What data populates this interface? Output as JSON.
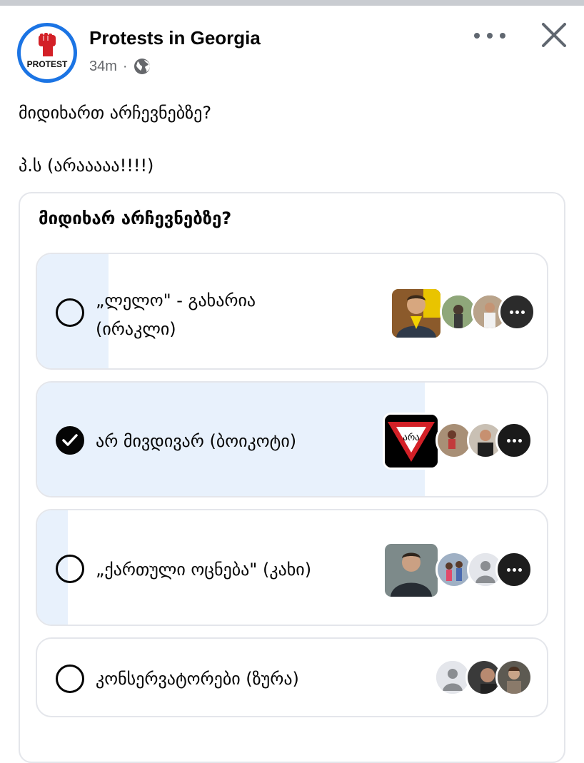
{
  "post": {
    "page_name": "Protests in Georgia",
    "logo_text": "PROTEST",
    "time": "34m",
    "dot": "·",
    "text_line1": "მიდიხართ არჩევნებზე?",
    "text_line2": "პ.ს  (არააააა!!!!)"
  },
  "poll": {
    "question": "მიდიხარ არჩევნებზე?",
    "options": [
      {
        "line1": "„ლელო\" - გახარია",
        "line2": "(ირაკლი)",
        "selected": false,
        "fill_percent": 14
      },
      {
        "label": "არ მივდივარ (ბოიკოტი)",
        "selected": true,
        "fill_percent": 76,
        "sign_text": "არა"
      },
      {
        "label": "„ქართული ოცნება\" (კახი)",
        "selected": false,
        "fill_percent": 6
      },
      {
        "label": "კონსერვატორები (ზურა)",
        "selected": false,
        "fill_percent": 0
      }
    ]
  },
  "icons": {
    "globe": "globe-icon",
    "more": "more-horizontal-icon",
    "close": "close-icon",
    "check": "checkmark-icon"
  },
  "colors": {
    "accent_blue": "#1b74e4",
    "poll_fill": "#e8f1fc",
    "border": "#e4e6eb",
    "secondary_text": "#65676b",
    "logo_red": "#d32027"
  }
}
